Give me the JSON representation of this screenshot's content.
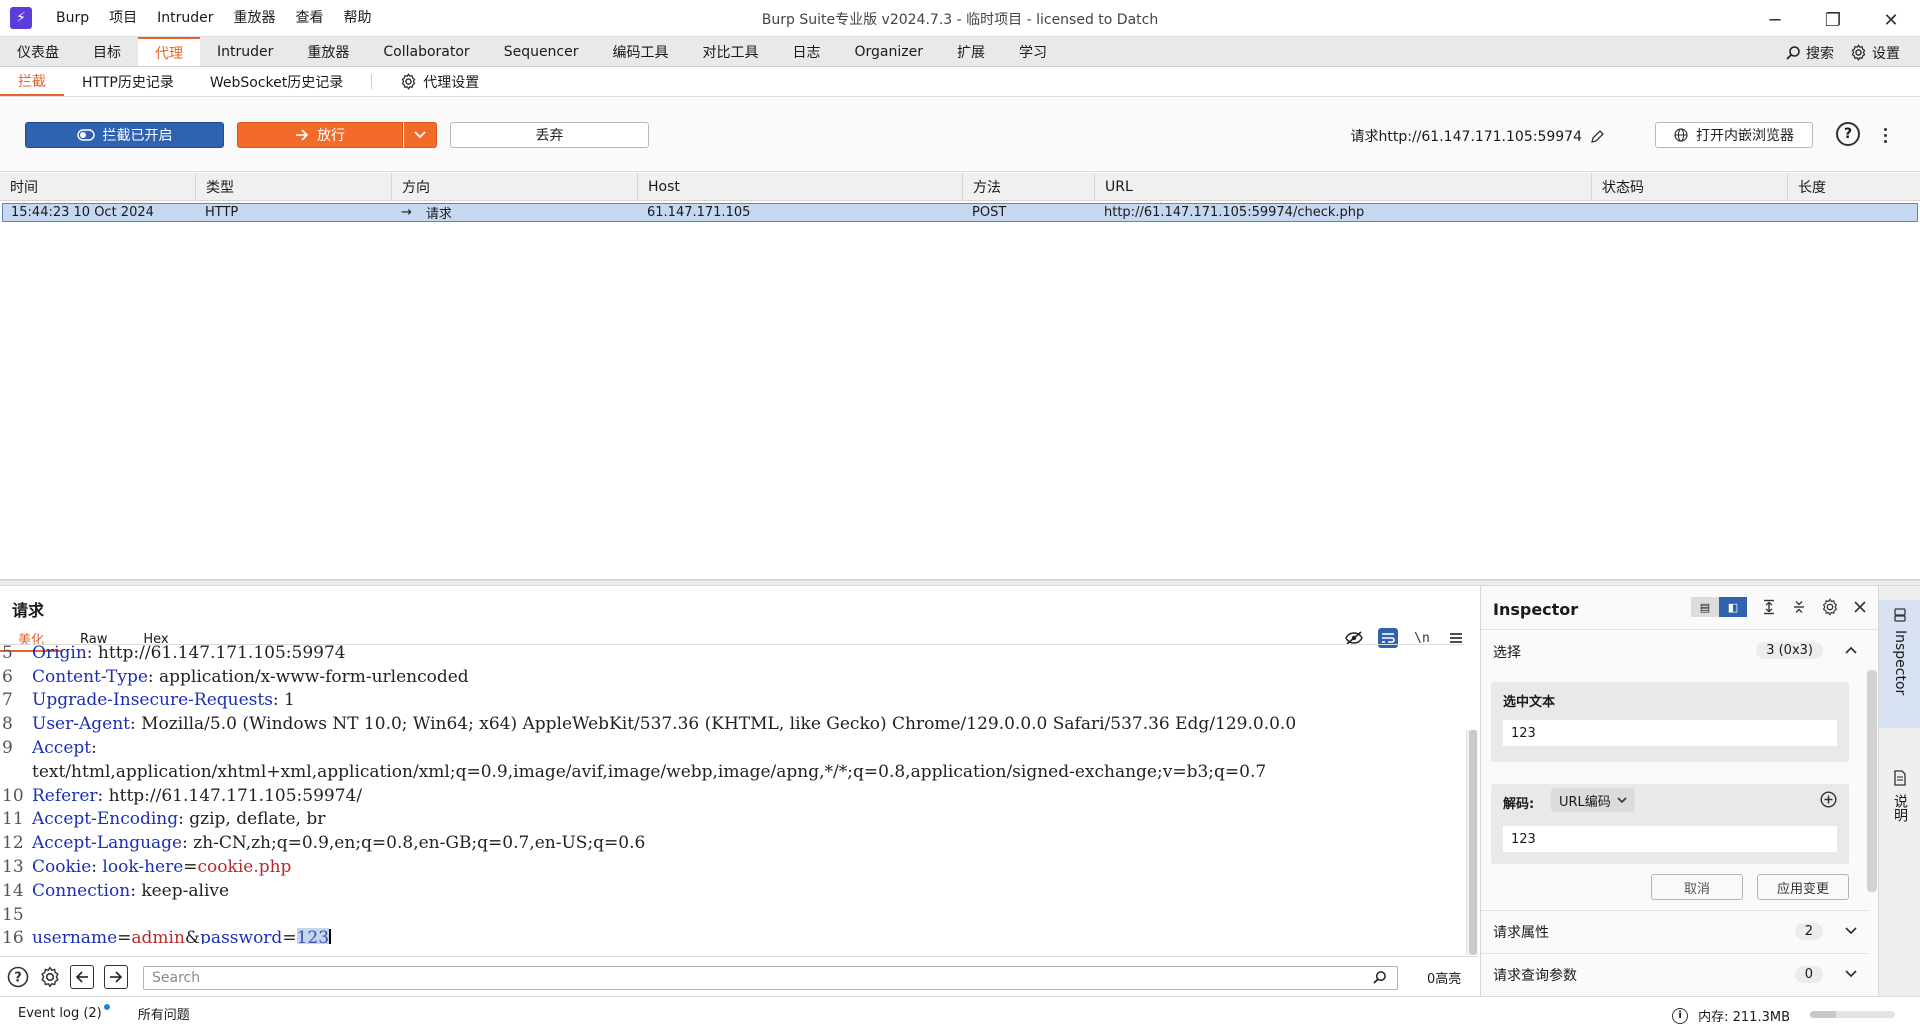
{
  "app": {
    "logo_glyph": "⚡",
    "window_title": "Burp Suite专业版  v2024.7.3 - 临时项目 - licensed to Datch",
    "menu": [
      "Burp",
      "项目",
      "Intruder",
      "重放器",
      "查看",
      "帮助"
    ],
    "window_controls": {
      "minimize": "─",
      "restore": "❐",
      "close": "✕"
    }
  },
  "tabs": {
    "items": [
      "仪表盘",
      "目标",
      "代理",
      "Intruder",
      "重放器",
      "Collaborator",
      "Sequencer",
      "编码工具",
      "对比工具",
      "日志",
      "Organizer",
      "扩展",
      "学习"
    ],
    "active": "代理",
    "search_label": "搜索",
    "settings_label": "设置"
  },
  "subtabs": {
    "items": [
      "拦截",
      "HTTP历史记录",
      "WebSocket历史记录"
    ],
    "active": "拦截",
    "proxy_settings": "代理设置"
  },
  "intercept": {
    "toggle_label": "拦截已开启",
    "forward_label": "放行",
    "drop_label": "丢弃",
    "request_target": "请求http://61.147.171.105:59974",
    "open_browser_label": "打开内嵌浏览器"
  },
  "table": {
    "headers": [
      "时间",
      "类型",
      "方向",
      "Host",
      "方法",
      "URL",
      "状态码",
      "长度"
    ],
    "rows": [
      {
        "time": "15:44:23 10 Oct 2024",
        "type": "HTTP",
        "direction_icon": "→",
        "direction": "请求",
        "host": "61.147.171.105",
        "method": "POST",
        "url": "http://61.147.171.105:59974/check.php",
        "status": "",
        "length": ""
      }
    ]
  },
  "editor": {
    "title": "请求",
    "tabs": [
      "美化",
      "Raw",
      "Hex"
    ],
    "active_tab": "美化",
    "lines": [
      {
        "n": "5",
        "k": "Origin",
        "v": ": http://61.147.171.105:59974"
      },
      {
        "n": "6",
        "k": "Content-Type",
        "v": ": application/x-www-form-urlencoded"
      },
      {
        "n": "7",
        "k": "Upgrade-Insecure-Requests",
        "v": ": 1"
      },
      {
        "n": "8",
        "k": "User-Agent",
        "v": ": Mozilla/5.0 (Windows NT 10.0; Win64; x64) AppleWebKit/537.36 (KHTML, like Gecko) Chrome/129.0.0.0 Safari/537.36 Edg/129.0.0.0"
      },
      {
        "n": "9",
        "k": "Accept",
        "v": ":"
      },
      {
        "n": "",
        "k": "",
        "v": "text/html,application/xhtml+xml,application/xml;q=0.9,image/avif,image/webp,image/apng,*/*;q=0.8,application/signed-exchange;v=b3;q=0.7"
      },
      {
        "n": "10",
        "k": "Referer",
        "v": ": http://61.147.171.105:59974/"
      },
      {
        "n": "11",
        "k": "Accept-Encoding",
        "v": ": gzip, deflate, br"
      },
      {
        "n": "12",
        "k": "Accept-Language",
        "v": ": zh-CN,zh;q=0.9,en;q=0.8,en-GB;q=0.7,en-US;q=0.6"
      }
    ],
    "cookie_line": {
      "n": "13",
      "k": "Cookie",
      "sep": ": ",
      "name": "look-here",
      "eq": "=",
      "value": "cookie.php"
    },
    "connection_line": {
      "n": "14",
      "k": "Connection",
      "v": ": keep-alive"
    },
    "blank_line": {
      "n": "15"
    },
    "body_line": {
      "n": "16",
      "k1": "username",
      "eq1": "=",
      "v1": "admin",
      "amp": "&",
      "k2": "password",
      "eq2": "=",
      "v2": "123"
    }
  },
  "searchbar": {
    "placeholder": "Search",
    "highlight_count": "0高亮"
  },
  "inspector": {
    "title": "Inspector",
    "selection_label": "选择",
    "selection_badge": "3 (0x3)",
    "selected_text_label": "选中文本",
    "selected_text_value": "123",
    "decode_label": "解码:",
    "decode_type": "URL编码",
    "decoded_value": "123",
    "cancel_label": "取消",
    "apply_label": "应用变更",
    "request_attributes": "请求属性",
    "request_attributes_count": "2",
    "query_params": "请求查询参数",
    "query_params_count": "0"
  },
  "sidestrip": {
    "inspector_label": "Inspector",
    "notes_label": "说明"
  },
  "status": {
    "event_log": "Event log (2)",
    "all_issues": "所有问题",
    "memory": "内存: 211.3MB",
    "memory_fraction": 0.3
  },
  "colors": {
    "accent_orange": "#e8622a",
    "intercept_blue": "#2f63b0",
    "selection_blue": "#c6d8ef",
    "header_key_blue": "#1b2fb5",
    "cookie_red": "#b72a2a"
  }
}
